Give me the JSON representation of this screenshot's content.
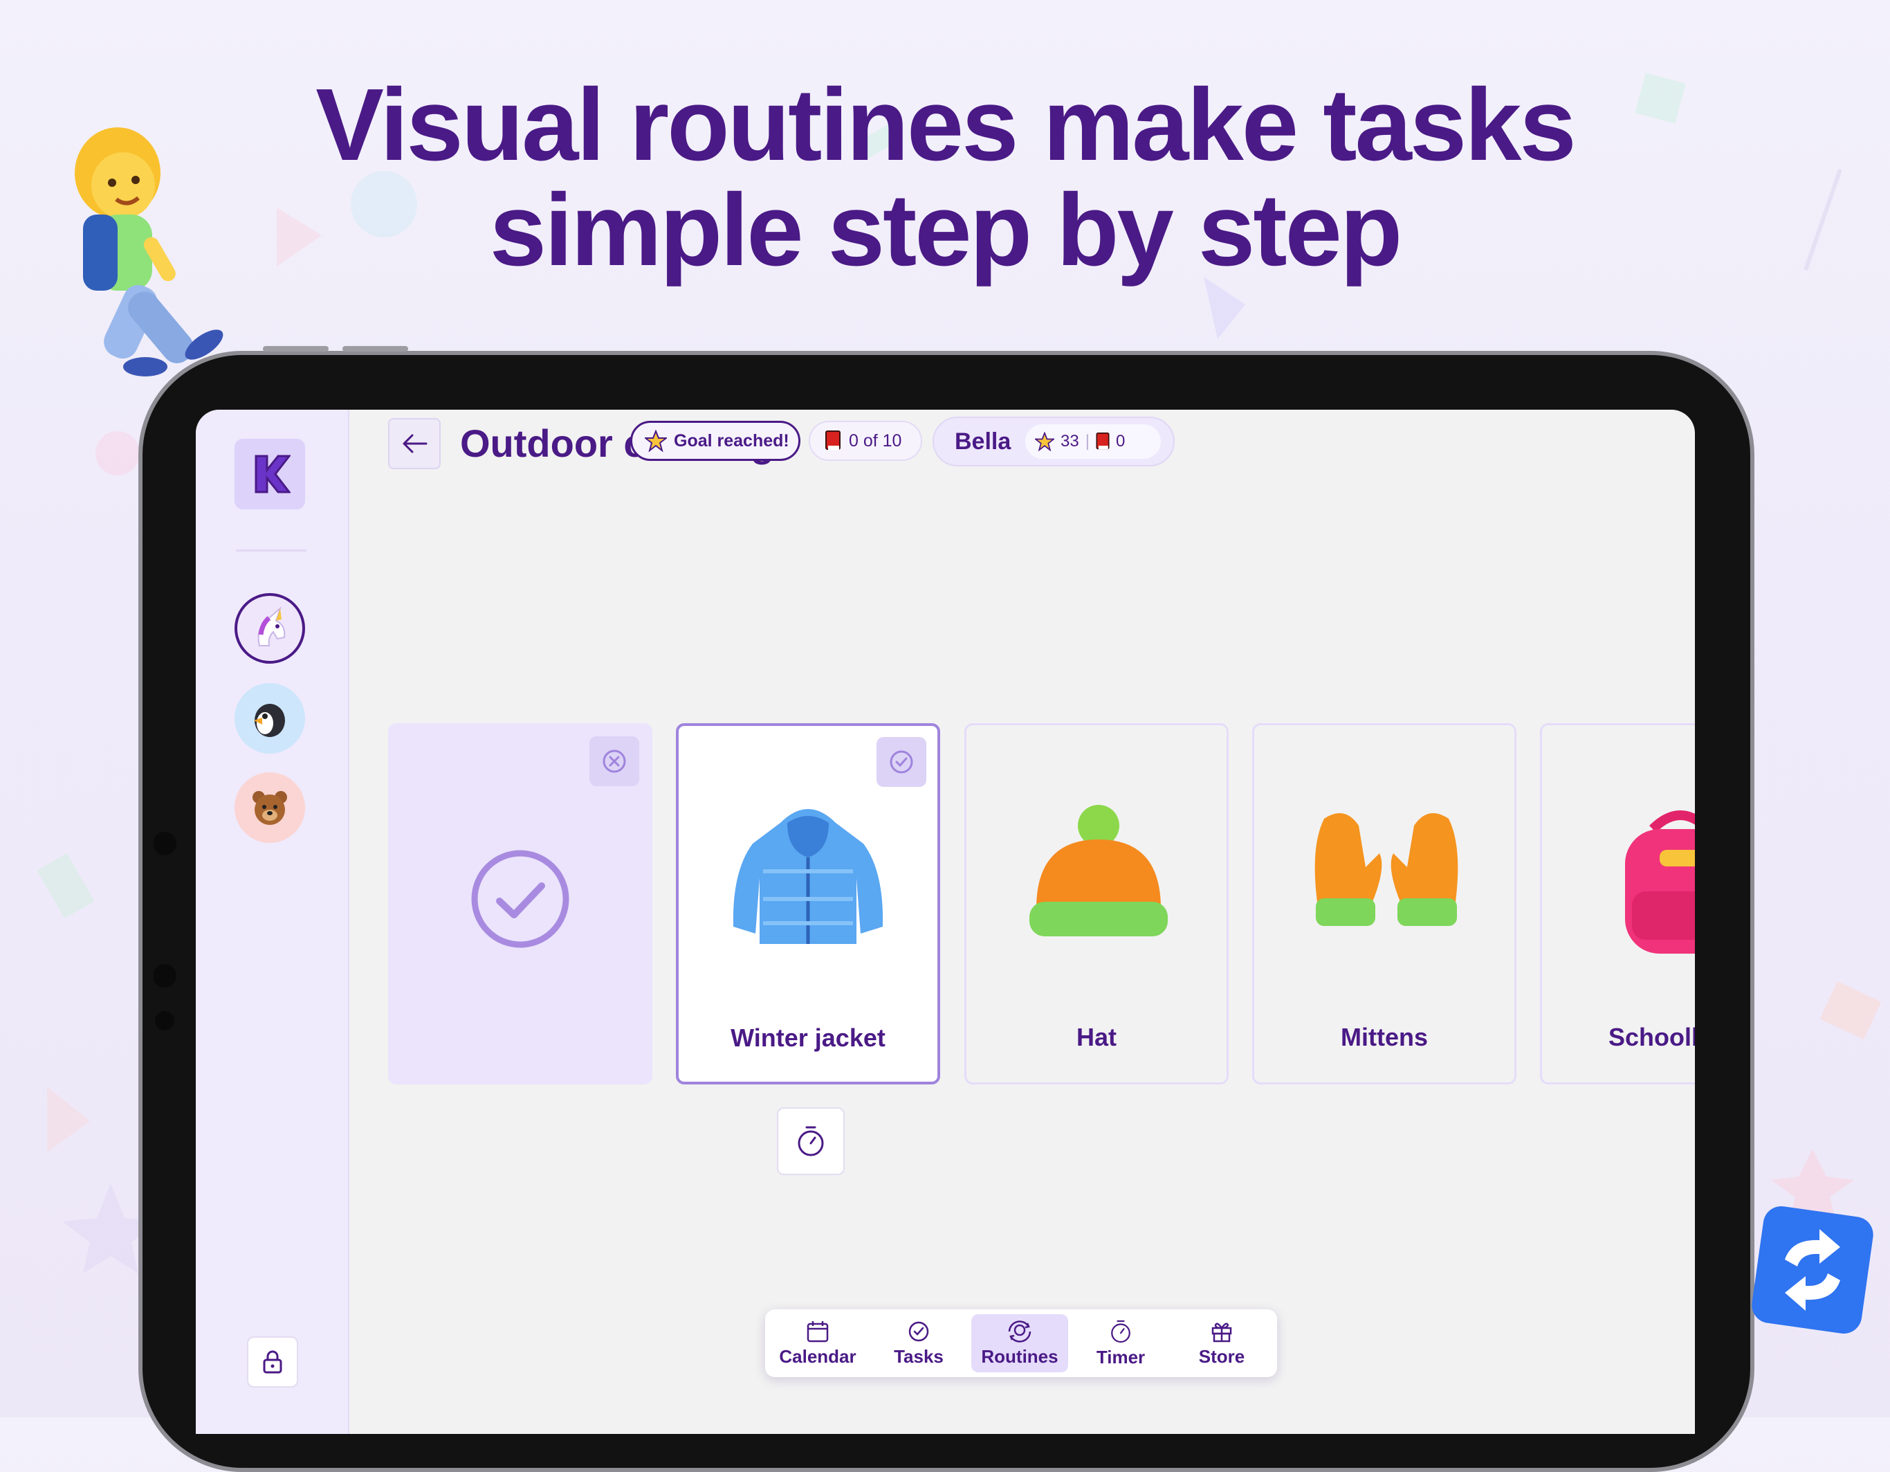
{
  "headline": {
    "line1": "Visual routines make tasks",
    "line2": "simple step by step"
  },
  "header": {
    "title": "Outdoor clothing",
    "goal_badge": "Goal reached!",
    "progress": "0 of 10",
    "user_name": "Bella",
    "stars": "33",
    "tokens": "0"
  },
  "sidebar": {
    "avatars": [
      {
        "icon": "unicorn-icon",
        "color": "#efe6fb",
        "selected": true
      },
      {
        "icon": "penguin-icon",
        "color": "#cde6fb",
        "selected": false
      },
      {
        "icon": "bear-icon",
        "color": "#fbd5d3",
        "selected": false
      }
    ]
  },
  "cards": [
    {
      "label": "",
      "state": "done",
      "icon": "check-circle-icon"
    },
    {
      "label": "Winter jacket",
      "state": "active",
      "icon": "jacket-icon"
    },
    {
      "label": "Hat",
      "state": "pending",
      "icon": "beanie-hat-icon"
    },
    {
      "label": "Mittens",
      "state": "pending",
      "icon": "mittens-icon"
    },
    {
      "label": "Schoolbag",
      "state": "pending",
      "icon": "backpack-icon"
    }
  ],
  "nav": [
    {
      "label": "Calendar",
      "icon": "calendar-icon"
    },
    {
      "label": "Tasks",
      "icon": "check-circle-icon"
    },
    {
      "label": "Routines",
      "icon": "routines-icon",
      "active": true
    },
    {
      "label": "Timer",
      "icon": "stopwatch-icon"
    },
    {
      "label": "Store",
      "icon": "gift-icon"
    }
  ],
  "colors": {
    "brand_purple": "#4a1a86",
    "accent_lilac": "#9f84dd",
    "card_done": "#ebe4fc"
  }
}
